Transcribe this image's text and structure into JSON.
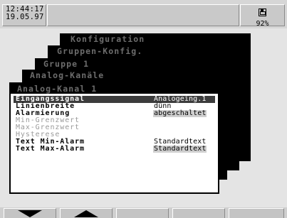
{
  "status": {
    "time": "12:44:17",
    "date": "19.05.97",
    "disk_icon": "floppy-disk-icon",
    "disk_usage": "92%"
  },
  "windows": [
    {
      "title": "Konfiguration"
    },
    {
      "title": "Gruppen-Konfig."
    },
    {
      "title": "Gruppe 1"
    },
    {
      "title": "Analog-Kanäle"
    },
    {
      "title": "Analog-Kanal 1"
    }
  ],
  "menu": {
    "items": [
      {
        "label": "Eingangssignal",
        "value": "Analogeing.1"
      },
      {
        "label": "Linienbreite",
        "value": "dünn"
      },
      {
        "label": "Alarmierung",
        "value": "abgeschaltet"
      },
      {
        "label": "Min-Grenzwert",
        "value": ""
      },
      {
        "label": "Max-Grenzwert",
        "value": ""
      },
      {
        "label": "Hysterese",
        "value": ""
      },
      {
        "label": "Text Min-Alarm",
        "value": "Standardtext"
      },
      {
        "label": "Text Max-Alarm",
        "value": "Standardtext"
      }
    ],
    "selected_index": 0,
    "disabled": [
      "Min-Grenzwert",
      "Max-Grenzwert",
      "Hysterese"
    ]
  },
  "softkeys": [
    {
      "icon": "arrow-down-icon"
    },
    {
      "icon": "arrow-up-icon"
    },
    {
      "icon": ""
    },
    {
      "icon": ""
    },
    {
      "icon": ""
    }
  ]
}
